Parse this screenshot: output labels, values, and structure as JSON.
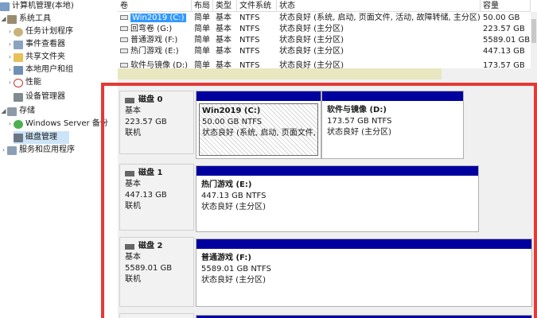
{
  "tree": {
    "items": [
      {
        "label": "计算机管理(本地)",
        "icon": "computer-management-icon"
      },
      {
        "label": "系统工具",
        "icon": "tools-icon"
      },
      {
        "label": "任务计划程序",
        "icon": "clock-icon"
      },
      {
        "label": "事件查看器",
        "icon": "event-log-icon"
      },
      {
        "label": "共享文件夹",
        "icon": "folder-icon"
      },
      {
        "label": "本地用户和组",
        "icon": "users-icon"
      },
      {
        "label": "性能",
        "icon": "performance-icon"
      },
      {
        "label": "设备管理器",
        "icon": "device-manager-icon"
      },
      {
        "label": "存储",
        "icon": "storage-icon"
      },
      {
        "label": "Windows Server 备份",
        "icon": "backup-icon"
      },
      {
        "label": "磁盘管理",
        "icon": "disk-management-icon"
      },
      {
        "label": "服务和应用程序",
        "icon": "services-icon"
      }
    ]
  },
  "volumes": {
    "headers": [
      "卷",
      "布局",
      "类型",
      "文件系统",
      "状态",
      "容量"
    ],
    "rows": [
      [
        "Win2019 (C:)",
        "简单",
        "基本",
        "NTFS",
        "状态良好 (系统, 启动, 页面文件, 活动, 故障转储, 主分区)",
        "50.00 GB"
      ],
      [
        "回弯卷 (G:)",
        "简单",
        "基本",
        "NTFS",
        "状态良好 (主分区)",
        "223.57 GB"
      ],
      [
        "普通游戏 (F:)",
        "简单",
        "基本",
        "NTFS",
        "状态良好 (主分区)",
        "5589.01 GB"
      ],
      [
        "热门游戏 (E:)",
        "简单",
        "基本",
        "NTFS",
        "状态良好 (主分区)",
        "447.13 GB"
      ],
      [
        "软件与镜像 (D:)",
        "简单",
        "基本",
        "NTFS",
        "状态良好 (主分区)",
        "173.57 GB"
      ]
    ]
  },
  "disks": [
    {
      "name": "磁盘 0",
      "type": "基本",
      "size": "223.57 GB",
      "status": "联机",
      "partitions": [
        {
          "name": "Win2019  (C:)",
          "size": "50.00 GB NTFS",
          "status": "状态良好 (系统, 启动, 页面文件, 活动, 故障转储, 主分区)"
        },
        {
          "name": "软件与镜像  (D:)",
          "size": "173.57 GB NTFS",
          "status": "状态良好 (主分区)"
        }
      ]
    },
    {
      "name": "磁盘 1",
      "type": "基本",
      "size": "447.13 GB",
      "status": "联机",
      "partitions": [
        {
          "name": "热门游戏  (E:)",
          "size": "447.13 GB NTFS",
          "status": "状态良好 (主分区)"
        }
      ]
    },
    {
      "name": "磁盘 2",
      "type": "基本",
      "size": "5589.01 GB",
      "status": "联机",
      "partitions": [
        {
          "name": "普通游戏  (F:)",
          "size": "5589.01 GB NTFS",
          "status": "状态良好 (主分区)"
        }
      ]
    }
  ],
  "colors": {
    "primary_partition": "#00009f",
    "highlight": "#e53935",
    "selection": "#3399ff"
  }
}
